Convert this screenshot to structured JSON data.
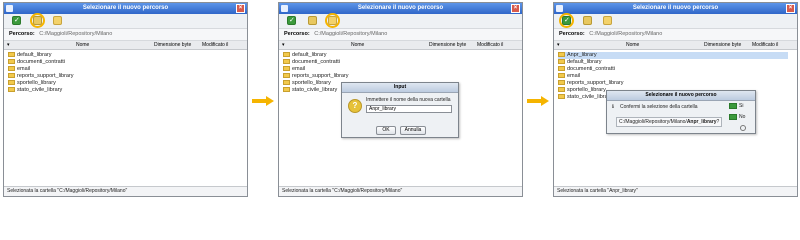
{
  "windows": [
    {
      "title": "Selezionare il nuovo percorso",
      "path_label": "Percorso:",
      "path_value": "C:/Maggioli/Repository/Milano",
      "columns": [
        "Nome",
        "Dimensione byte",
        "Modificato il"
      ],
      "items": [
        "default_library",
        "documenti_contratti",
        "email",
        "reports_support_library",
        "sportello_library",
        "stato_civile_library"
      ],
      "status": "Selezionata la cartella \"C:/Maggioli/Repository/Milano\""
    },
    {
      "title": "Selezionare il nuovo percorso",
      "path_label": "Percorso:",
      "path_value": "C:/Maggioli/Repository/Milano",
      "columns": [
        "Nome",
        "Dimensione byte",
        "Modificato il"
      ],
      "items": [
        "default_library",
        "documenti_contratti",
        "email",
        "reports_support_library",
        "sportello_library",
        "stato_civile_library"
      ],
      "status": "Selezionata la cartella \"C:/Maggioli/Repository/Milano\"",
      "dialog": {
        "title": "Input",
        "message": "Immettere il nome della nuova cartella",
        "input_value": "Anpr_library",
        "ok": "OK",
        "cancel": "Annulla"
      }
    },
    {
      "title": "Selezionare il nuovo percorso",
      "path_label": "Percorso:",
      "path_value": "C:/Maggioli/Repository/Milano",
      "columns": [
        "Nome",
        "Dimensione byte",
        "Modificato il"
      ],
      "items": [
        "Anpr_library",
        "default_library",
        "documenti_contratti",
        "email",
        "reports_support_library",
        "sportello_library",
        "stato_civile_library"
      ],
      "status": "Selezionata la cartella \"Anpr_library\"",
      "dialog": {
        "title": "Selezionare il nuovo percorso",
        "message": "Confermi la selezione della cartella",
        "path_prefix": "C:/Maggioli/Repository/Milano/",
        "path_bold": "Anpr_library",
        "path_suffix": "?",
        "yes": "Si",
        "no": "No"
      }
    }
  ],
  "accent_color": "#f5b400",
  "icons": {
    "ok": "check-icon",
    "up": "folder-up-icon",
    "new": "new-folder-icon",
    "column": "folder-icon",
    "question": "question-icon",
    "info": "info-icon",
    "settings": "gear-icon"
  }
}
